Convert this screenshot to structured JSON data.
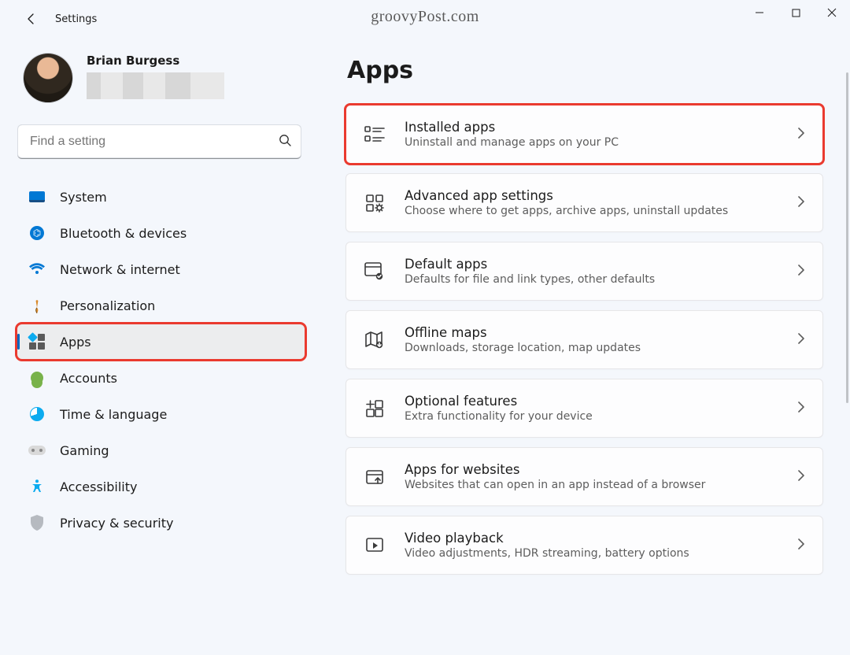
{
  "window": {
    "title": "Settings",
    "watermark": "groovyPost.com"
  },
  "profile": {
    "name": "Brian Burgess"
  },
  "search": {
    "placeholder": "Find a setting"
  },
  "sidebar": {
    "items": [
      {
        "id": "system",
        "label": "System"
      },
      {
        "id": "bluetooth",
        "label": "Bluetooth & devices"
      },
      {
        "id": "network",
        "label": "Network & internet"
      },
      {
        "id": "personalize",
        "label": "Personalization"
      },
      {
        "id": "apps",
        "label": "Apps"
      },
      {
        "id": "accounts",
        "label": "Accounts"
      },
      {
        "id": "time",
        "label": "Time & language"
      },
      {
        "id": "gaming",
        "label": "Gaming"
      },
      {
        "id": "accessibility",
        "label": "Accessibility"
      },
      {
        "id": "privacy",
        "label": "Privacy & security"
      }
    ]
  },
  "page": {
    "title": "Apps",
    "cards": [
      {
        "title": "Installed apps",
        "sub": "Uninstall and manage apps on your PC"
      },
      {
        "title": "Advanced app settings",
        "sub": "Choose where to get apps, archive apps, uninstall updates"
      },
      {
        "title": "Default apps",
        "sub": "Defaults for file and link types, other defaults"
      },
      {
        "title": "Offline maps",
        "sub": "Downloads, storage location, map updates"
      },
      {
        "title": "Optional features",
        "sub": "Extra functionality for your device"
      },
      {
        "title": "Apps for websites",
        "sub": "Websites that can open in an app instead of a browser"
      },
      {
        "title": "Video playback",
        "sub": "Video adjustments, HDR streaming, battery options"
      }
    ]
  }
}
